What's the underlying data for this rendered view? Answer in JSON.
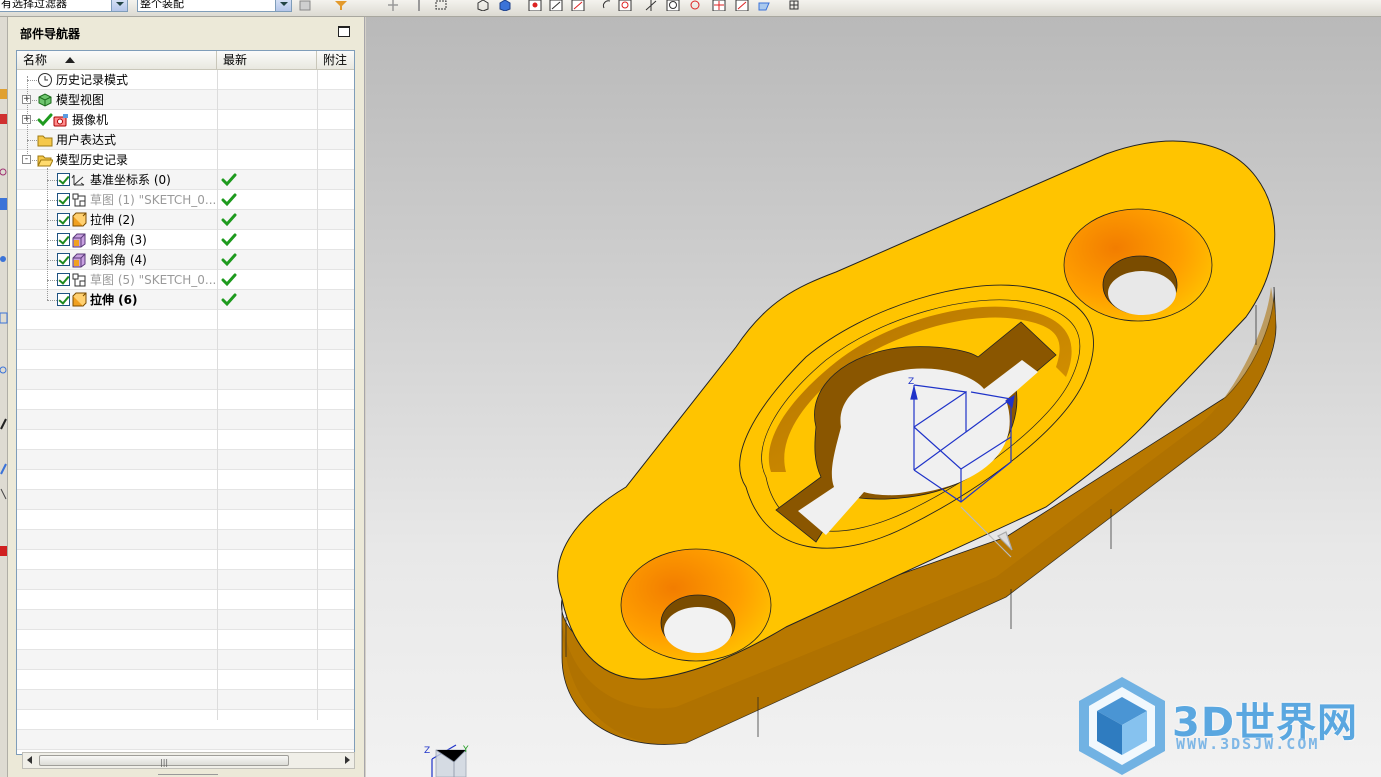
{
  "toolbar": {
    "filter_combo": "有选择过滤器",
    "assembly_combo": "整个装配"
  },
  "navigator": {
    "title": "部件导航器",
    "columns": {
      "name": "名称",
      "latest": "最新",
      "note": "附注"
    },
    "items": [
      {
        "label": "历史记录模式",
        "icon": "clock-icon",
        "level": 0,
        "expander": "",
        "checked": false,
        "latest": false,
        "style": "normal"
      },
      {
        "label": "模型视图",
        "icon": "model-views-icon",
        "level": 0,
        "expander": "+",
        "checked": false,
        "latest": false,
        "style": "normal"
      },
      {
        "label": "摄像机",
        "icon": "camera-icon",
        "level": 0,
        "expander": "+",
        "checked": false,
        "latest": false,
        "style": "normal",
        "green_tick": true
      },
      {
        "label": "用户表达式",
        "icon": "folder-icon",
        "level": 0,
        "expander": "",
        "checked": false,
        "latest": false,
        "style": "normal"
      },
      {
        "label": "模型历史记录",
        "icon": "folder-open-icon",
        "level": 0,
        "expander": "-",
        "checked": false,
        "latest": false,
        "style": "normal"
      },
      {
        "label": "基准坐标系 (0)",
        "icon": "datum-csys-icon",
        "level": 1,
        "expander": "",
        "checked": true,
        "latest": true,
        "style": "normal"
      },
      {
        "label": "草图 (1) \"SKETCH_0...",
        "icon": "sketch-icon",
        "level": 1,
        "expander": "",
        "checked": true,
        "latest": true,
        "style": "gray"
      },
      {
        "label": "拉伸 (2)",
        "icon": "extrude-icon",
        "level": 1,
        "expander": "",
        "checked": true,
        "latest": true,
        "style": "normal"
      },
      {
        "label": "倒斜角 (3)",
        "icon": "chamfer-icon",
        "level": 1,
        "expander": "",
        "checked": true,
        "latest": true,
        "style": "normal"
      },
      {
        "label": "倒斜角 (4)",
        "icon": "chamfer-icon",
        "level": 1,
        "expander": "",
        "checked": true,
        "latest": true,
        "style": "normal"
      },
      {
        "label": "草图 (5) \"SKETCH_0...",
        "icon": "sketch-icon",
        "level": 1,
        "expander": "",
        "checked": true,
        "latest": true,
        "style": "gray"
      },
      {
        "label": "拉伸 (6)",
        "icon": "extrude-icon",
        "level": 1,
        "expander": "",
        "checked": true,
        "latest": true,
        "style": "bold"
      }
    ]
  },
  "viewport": {
    "triad_labels": {
      "z": "Z",
      "y": "Y"
    },
    "csys_label": "Z"
  },
  "watermark": {
    "brand": "3D世界网",
    "url": "WWW.3DSJW.COM"
  },
  "colors": {
    "part_top": "#ffc400",
    "part_side": "#c98a00",
    "csys_blue": "#1f33c9",
    "watermark_blue": "#5aa7e0"
  }
}
